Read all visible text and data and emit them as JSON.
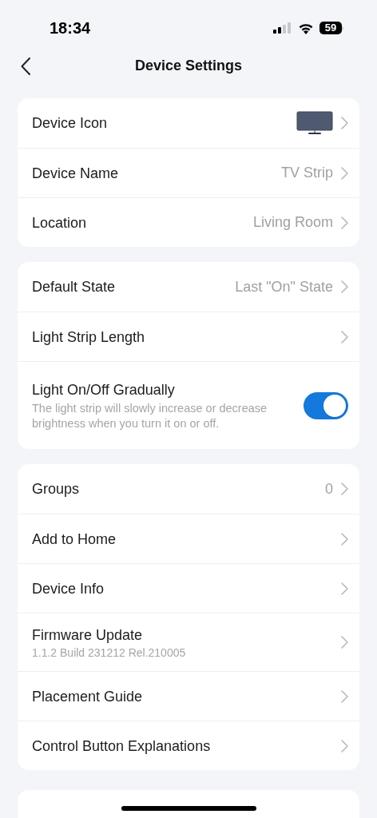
{
  "status_bar": {
    "time": "18:34",
    "battery": "59"
  },
  "header": {
    "title": "Device Settings"
  },
  "sections": [
    {
      "rows": [
        {
          "kind": "icon",
          "label": "Device Icon"
        },
        {
          "kind": "value",
          "label": "Device Name",
          "value": "TV Strip"
        },
        {
          "kind": "value",
          "label": "Location",
          "value": "Living Room"
        }
      ]
    },
    {
      "rows": [
        {
          "kind": "value",
          "label": "Default State",
          "value": "Last \"On\" State"
        },
        {
          "kind": "value",
          "label": "Light Strip Length"
        },
        {
          "kind": "toggle",
          "label": "Light On/Off Gradually",
          "description": "The light strip will slowly increase or decrease brightness when you turn it on or off.",
          "on": true
        }
      ]
    },
    {
      "rows": [
        {
          "kind": "value",
          "label": "Groups",
          "value": "0"
        },
        {
          "kind": "value",
          "label": "Add to Home"
        },
        {
          "kind": "value",
          "label": "Device Info"
        },
        {
          "kind": "value",
          "label": "Firmware Update",
          "description": "1.1.2 Build 231212 Rel.210005"
        },
        {
          "kind": "value",
          "label": "Placement Guide"
        },
        {
          "kind": "value",
          "label": "Control Button Explanations"
        }
      ]
    }
  ]
}
